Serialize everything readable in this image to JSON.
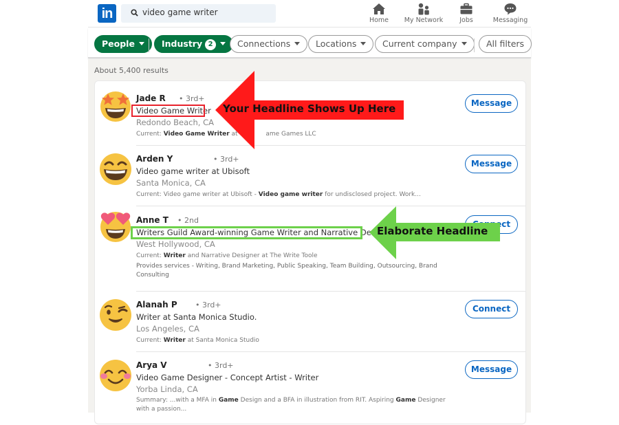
{
  "header": {
    "logo": "in",
    "search_value": "video game writer",
    "nav": [
      {
        "label": "Home",
        "icon": "home-icon"
      },
      {
        "label": "My Network",
        "icon": "network-icon"
      },
      {
        "label": "Jobs",
        "icon": "briefcase-icon"
      },
      {
        "label": "Messaging",
        "icon": "chat-icon"
      }
    ]
  },
  "filters": [
    {
      "label": "People",
      "active": true
    },
    {
      "label": "Industry",
      "active": true,
      "badge": "2"
    },
    {
      "label": "Connections",
      "active": false
    },
    {
      "label": "Locations",
      "active": false
    },
    {
      "label": "Current company",
      "active": false
    },
    {
      "label": "All filters",
      "active": false
    }
  ],
  "results": {
    "count_label": "About 5,400 results",
    "people": [
      {
        "name": "Jade R",
        "degree": "• 3rd+",
        "headline": "Video Game Writer",
        "location": "Redondo Beach, CA",
        "snippet_prefix": "Current: ",
        "snippet_bold": "Video Game Writer",
        "snippet_rest": " at Vicious Game Games LLC",
        "snippet_visible_a": " at Vici",
        "snippet_visible_b": "ame Games LLC",
        "action": "Message",
        "avatar": "star-struck-emoji"
      },
      {
        "name": "Arden Y",
        "degree": "• 3rd+",
        "headline": "Video game writer at Ubisoft",
        "location": "Santa Monica, CA",
        "snippet_prefix": "Current: Video game writer at Ubisoft - ",
        "snippet_bold": "Video game writer",
        "snippet_rest": " for undisclosed project. Work...",
        "action": "Message",
        "avatar": "grinning-emoji"
      },
      {
        "name": "Anne T",
        "degree": "• 2nd",
        "headline": "Writers Guild Award-winning Game Writer and Narrative Designer",
        "location": "West Hollywood, CA",
        "snippet_prefix": "Current: ",
        "snippet_bold": "Writer",
        "snippet_rest": " and Narrative Designer at The Write Toole",
        "services": "Provides services - Writing, Brand Marketing, Public Speaking, Team Building, Outsourcing, Brand Consulting",
        "action": "Connect",
        "avatar": "heart-eyes-emoji"
      },
      {
        "name": "Alanah P",
        "degree": "• 3rd+",
        "headline": "Writer at Santa Monica Studio.",
        "location": "Los Angeles, CA",
        "snippet_prefix": "Current: ",
        "snippet_bold": "Writer",
        "snippet_rest": " at Santa Monica Studio",
        "action": "Connect",
        "avatar": "winking-emoji"
      },
      {
        "name": "Arya V",
        "degree": "• 3rd+",
        "headline": "Video Game Designer - Concept Artist - Writer",
        "location": "Yorba Linda, CA",
        "snippet_parts": [
          "Summary: ...with a MFA in ",
          "Game",
          " Design and a BFA in illustration from RIT. Aspiring ",
          "Game",
          " Designer with a passion..."
        ],
        "action": "Message",
        "avatar": "smiling-blush-emoji"
      }
    ]
  },
  "annotations": {
    "red_label": "Your Headline Shows Up Here",
    "green_label": "Elaborate Headline",
    "red_color": "#ff1a1a",
    "green_color": "#6dd14a"
  }
}
